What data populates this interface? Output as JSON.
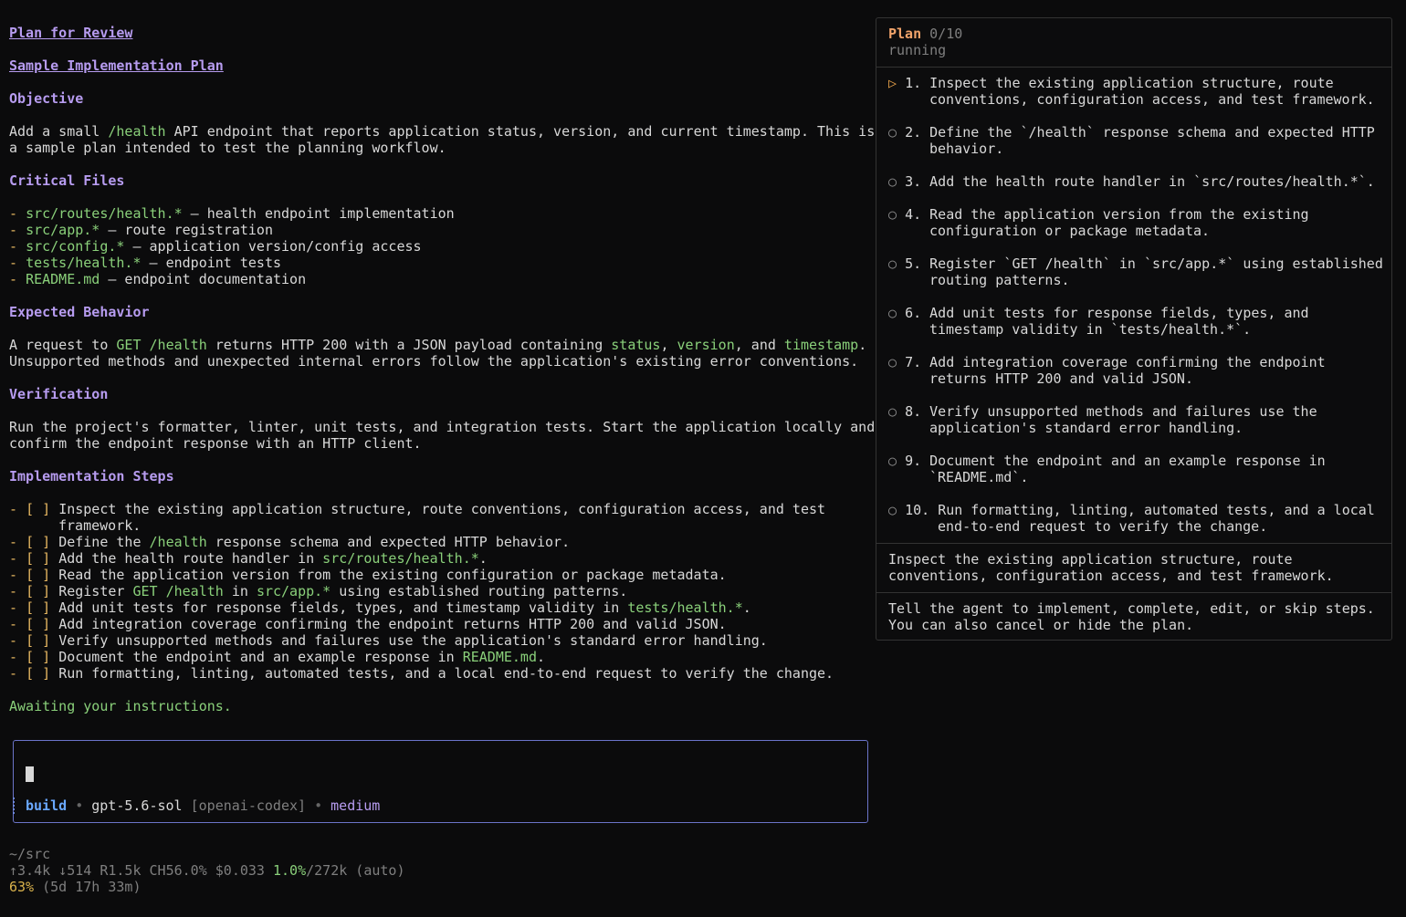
{
  "doc": {
    "title": "Plan for Review",
    "subtitle": "Sample Implementation Plan",
    "objective_heading": "Objective",
    "objective_line1": [
      "Add a small ",
      "/health",
      " API endpoint that reports application status, version, and current timestamp. This is"
    ],
    "objective_line2": "a sample plan intended to test the planning workflow.",
    "critical_heading": "Critical Files",
    "critical_files": [
      {
        "path": "src/routes/health.*",
        "desc": " — health endpoint implementation"
      },
      {
        "path": "src/app.*",
        "desc": " — route registration"
      },
      {
        "path": "src/config.*",
        "desc": " — application version/config access"
      },
      {
        "path": "tests/health.*",
        "desc": " — endpoint tests"
      },
      {
        "path": "README.md",
        "desc": " — endpoint documentation"
      }
    ],
    "expected_heading": "Expected Behavior",
    "expected_line1": [
      "A request to ",
      "GET /health",
      " returns HTTP 200 with a JSON payload containing ",
      "status",
      ", ",
      "version",
      ", and ",
      "timestamp",
      "."
    ],
    "expected_line2": "Unsupported methods and unexpected internal errors follow the application's existing error conventions.",
    "verification_heading": "Verification",
    "verification_line1": "Run the project's formatter, linter, unit tests, and integration tests. Start the application locally and",
    "verification_line2": "confirm the endpoint response with an HTTP client.",
    "steps_heading": "Implementation Steps",
    "checkbox": "[ ]",
    "steps": [
      [
        "Inspect the existing application structure, route conventions, configuration access, and test"
      ],
      [
        "Define the ",
        "/health",
        " response schema and expected HTTP behavior."
      ],
      [
        "Add the health route handler in ",
        "src/routes/health.*",
        "."
      ],
      [
        "Read the application version from the existing configuration or package metadata."
      ],
      [
        "Register ",
        "GET /health",
        " in ",
        "src/app.*",
        " using established routing patterns."
      ],
      [
        "Add unit tests for response fields, types, and timestamp validity in ",
        "tests/health.*",
        "."
      ],
      [
        "Add integration coverage confirming the endpoint returns HTTP 200 and valid JSON."
      ],
      [
        "Verify unsupported methods and failures use the application's standard error handling."
      ],
      [
        "Document the endpoint and an example response in ",
        "README.md",
        "."
      ],
      [
        "Run formatting, linting, automated tests, and a local end-to-end request to verify the change."
      ]
    ],
    "step1_continuation": "framework.",
    "awaiting": "Awaiting your instructions."
  },
  "plan": {
    "title": "Plan",
    "count": "0/10",
    "status": "running",
    "items": [
      {
        "marker": "▷",
        "num": "1.",
        "l1": "Inspect the existing application structure, route",
        "l2": "conventions, configuration access, and test framework."
      },
      {
        "marker": "○",
        "num": "2.",
        "l1": "Define the `/health` response schema and expected HTTP",
        "l2": "behavior."
      },
      {
        "marker": "○",
        "num": "3.",
        "l1": "Add the health route handler in `src/routes/health.*`.",
        "l2": ""
      },
      {
        "marker": "○",
        "num": "4.",
        "l1": "Read the application version from the existing",
        "l2": "configuration or package metadata."
      },
      {
        "marker": "○",
        "num": "5.",
        "l1": "Register `GET /health` in `src/app.*` using established",
        "l2": "routing patterns."
      },
      {
        "marker": "○",
        "num": "6.",
        "l1": "Add unit tests for response fields, types, and",
        "l2": "timestamp validity in `tests/health.*`."
      },
      {
        "marker": "○",
        "num": "7.",
        "l1": "Add integration coverage confirming the endpoint",
        "l2": "returns HTTP 200 and valid JSON."
      },
      {
        "marker": "○",
        "num": "8.",
        "l1": "Verify unsupported methods and failures use the",
        "l2": "application's standard error handling."
      },
      {
        "marker": "○",
        "num": "9.",
        "l1": "Document the endpoint and an example response in",
        "l2": "`README.md`."
      },
      {
        "marker": "○",
        "num": "10.",
        "l1": "Run formatting, linting, automated tests, and a local",
        "l2": "end-to-end request to verify the change."
      }
    ],
    "current_l1": "Inspect the existing application structure, route",
    "current_l2": "conventions, configuration access, and test framework.",
    "help_l1": "Tell the agent to implement, complete, edit, or skip steps.",
    "help_l2": "You can also cancel or hide the plan."
  },
  "input": {
    "mode": "build",
    "sep": "•",
    "model": "gpt-5.6-sol",
    "provider": "[openai-codex]",
    "effort": "medium"
  },
  "status": {
    "cwd": "~/src",
    "tokens_prefix": "↑3.4k ↓514 R1.5k CH56.0% $0.033 ",
    "context_pct": "1.0%",
    "context_rest": "/272k (auto)",
    "quota_pct": "63%",
    "quota_rest": " (5d 17h 33m)"
  }
}
